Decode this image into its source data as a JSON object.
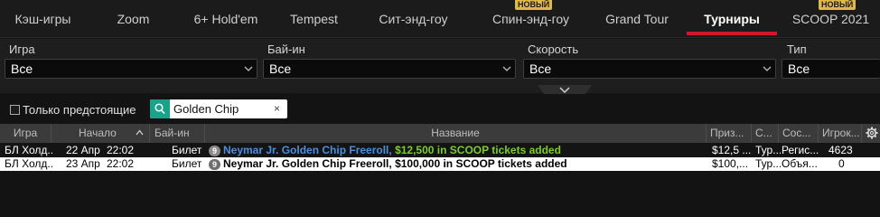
{
  "tabs": [
    {
      "label": "Кэш-игры"
    },
    {
      "label": "Zoom"
    },
    {
      "label": "6+ Hold'em"
    },
    {
      "label": "Tempest"
    },
    {
      "label": "Сит-энд-гоу"
    },
    {
      "label": "Спин-энд-гоу",
      "badge": "НОВЫЙ"
    },
    {
      "label": "Grand Tour"
    },
    {
      "label": "Турниры",
      "active": true
    },
    {
      "label": "SCOOP 2021",
      "badge": "НОВЫЙ"
    }
  ],
  "filters": {
    "game": {
      "label": "Игра",
      "value": "Все"
    },
    "buyin": {
      "label": "Бай-ин",
      "value": "Все"
    },
    "speed": {
      "label": "Скорость",
      "value": "Все"
    },
    "type": {
      "label": "Тип",
      "value": "Все"
    }
  },
  "search": {
    "upcoming_only_label": "Только предстоящие",
    "value": "Golden Chip",
    "clear": "×"
  },
  "table": {
    "headers": {
      "game": "Игра",
      "start": "Начало",
      "buyin": "Бай-ин",
      "name": "Название",
      "prize": "Приз...",
      "speed": "С...",
      "status": "Сос...",
      "players": "Игрок..."
    },
    "rows": [
      {
        "game": "БЛ Холд...",
        "date": "22 Апр",
        "time": "22:02",
        "buyin": "Билет",
        "level": "9",
        "name": "Neymar Jr. Golden Chip Freeroll,",
        "extra": " $12,500 in SCOOP tickets added",
        "prize": "$12,5 ...",
        "speed": "Тур...",
        "status": "Регис...",
        "players": "4623"
      },
      {
        "game": "БЛ Холд...",
        "date": "23 Апр",
        "time": "22:02",
        "buyin": "Билет",
        "level": "9",
        "name": "Neymar Jr. Golden Chip Freeroll,",
        "extra": "  $100,000 in SCOOP tickets added",
        "prize": "$100,...",
        "speed": "Тур...",
        "status": "Объя...",
        "players": "0"
      }
    ]
  },
  "colors": {
    "accent_red": "#d1172e",
    "search_teal": "#1aa38b",
    "badge_gold": "#e0b84a",
    "row_name_blue": "#4c8fe0",
    "row_extra_green": "#7ccc2e"
  }
}
